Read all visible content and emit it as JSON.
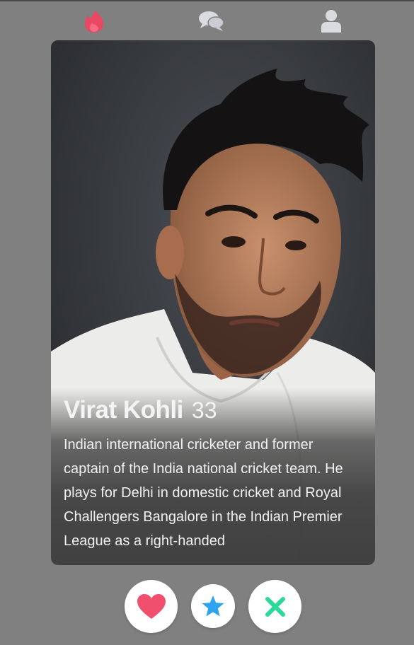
{
  "nav": {
    "items": [
      {
        "icon": "flame-icon",
        "color": "#e94763"
      },
      {
        "icon": "chat-icon",
        "color": "#d9dbe0"
      },
      {
        "icon": "user-icon",
        "color": "#d9dbe0"
      }
    ]
  },
  "profile": {
    "name": "Virat Kohli",
    "age": "33",
    "bio": "Indian international cricketer and former captain of the India national cricket team. He plays for Delhi in domestic cricket and Royal Challengers Bangalore in the Indian Premier League as a right-handed"
  },
  "actions": {
    "like": {
      "icon": "heart-icon",
      "color": "#f0506e"
    },
    "superlike": {
      "icon": "star-icon",
      "color": "#2ea4f0"
    },
    "dislike": {
      "icon": "close-icon",
      "color": "#2bd99a"
    }
  }
}
